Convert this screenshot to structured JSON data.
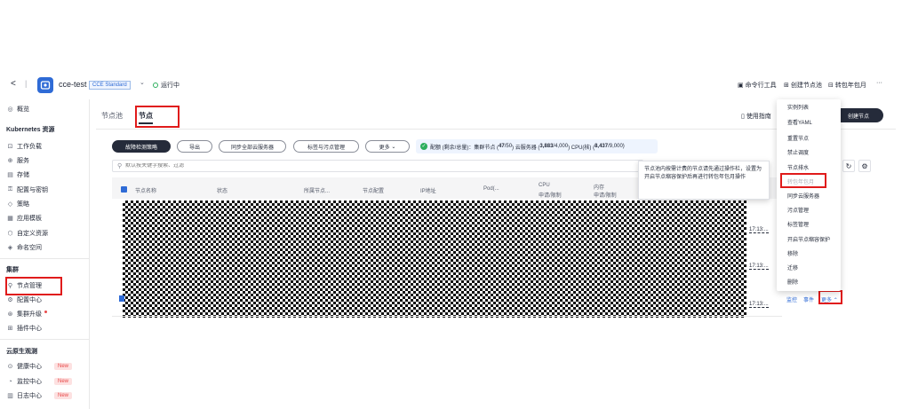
{
  "topbar": {
    "back": "<",
    "sep": "|",
    "cluster_name": "cce-test",
    "cluster_type": "CCE Standard",
    "status": "运行中",
    "actions": {
      "cli": "命令行工具",
      "create_pool": "创建节点池",
      "to_yearly": "转包年包月",
      "more": "···"
    }
  },
  "sidebar": {
    "overview": "概览",
    "k8s_section": "Kubernetes 资源",
    "k8s_items": [
      "工作负载",
      "服务",
      "存储",
      "配置与密钥",
      "策略",
      "应用模板",
      "自定义资源",
      "命名空间"
    ],
    "cluster_section": "集群",
    "cluster_items": [
      "节点管理",
      "配置中心",
      "集群升级",
      "插件中心"
    ],
    "observe_section": "云原生观测",
    "observe_items": [
      "健康中心",
      "监控中心",
      "日志中心"
    ],
    "new_badge": "New"
  },
  "tabs": {
    "pool": "节点池",
    "node": "节点"
  },
  "guide": "使用指南",
  "create_node": "创建节点",
  "toolbar": {
    "fault_policy": "故障检测策略",
    "export": "导出",
    "sync_all": "同步全部云服务器",
    "labels_taints": "标签与污点管理",
    "more": "更多",
    "quota_label": "配额 (剩余/总量)：",
    "quota_nodes_label": "集群节点 (",
    "quota_nodes": "47",
    "quota_nodes_total": "/50",
    "quota_ecs_label": ") 云服务器 (",
    "quota_ecs": "3,883",
    "quota_ecs_total": "/4,000",
    "quota_cpu_label": ") CPU(核) (",
    "quota_cpu": "8,437",
    "quota_cpu_total": "/9,000",
    "quota_end": ")"
  },
  "search": {
    "placeholder": "默认按关键字搜索、过滤"
  },
  "table": {
    "headers": [
      "节点名称",
      "状态",
      "所属节点...",
      "节点配置",
      "IP地址",
      "Pod(...",
      "CPU",
      "申请/限制",
      "内存",
      "申请/限制"
    ],
    "row_times": [
      "17:13:...",
      "17:13:...",
      "17:13:..."
    ],
    "row_actions": {
      "monitor": "监控",
      "events": "事件",
      "more": "更多"
    }
  },
  "tooltip": {
    "text": "节点池内按需计费的节点请先通过操作栏，设置为开启节点缩容保护后再进行转包年包月操作"
  },
  "menu": {
    "items": [
      "实例列表",
      "查看YAML",
      "重置节点",
      "禁止调度",
      "节点排水",
      "转包年包月",
      "同步云服务器",
      "污点管理",
      "标签管理",
      "开启节点缩容保护",
      "移除",
      "迁移",
      "删除"
    ]
  },
  "colors": {
    "primary": "#252b3a",
    "link": "#2f6bd6",
    "highlight": "#e01b1b",
    "success": "#2cae5c"
  }
}
